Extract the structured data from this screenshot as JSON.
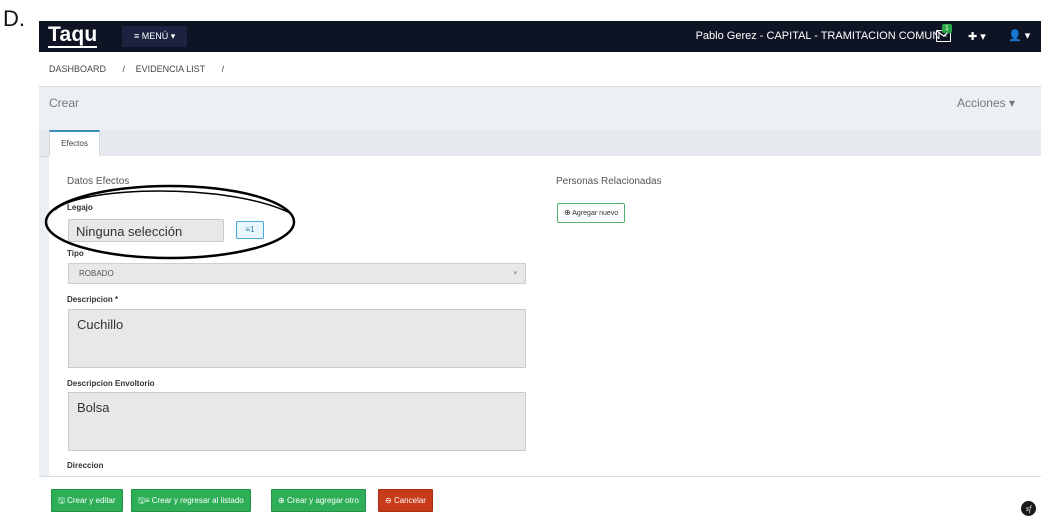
{
  "outer_label": "D.",
  "topbar": {
    "logo": "Taqu",
    "menu_label": "≡  MENÚ ▾",
    "user_info": "Pablo Gerez - CAPITAL - TRAMITACION COMUN -",
    "mail_badge": "1",
    "plus_label": "✚ ▾",
    "user_label": "👤 ▾"
  },
  "breadcrumb": {
    "item1": "DASHBOARD",
    "sep1": "/",
    "item2": "EVIDENCIA LIST",
    "sep2": "/"
  },
  "page": {
    "title": "Crear",
    "actions_label": "Acciones ▾"
  },
  "tabs": {
    "efectos": "Efectos"
  },
  "form": {
    "datos_title": "Datos Efectos",
    "legajo_label": "Legajo",
    "legajo_value": "Ninguna selección",
    "legajo_list_btn": "≡1",
    "tipo_label": "Tipo",
    "tipo_value": "ROBADO",
    "descripcion_label": "Descripcion *",
    "descripcion_value": "Cuchillo",
    "envoltorio_label": "Descripcion Envoltorio",
    "envoltorio_value": "Bolsa",
    "direccion_label": "Direccion",
    "personas_title": "Personas Relacionadas",
    "agregar_nuevo": "Agregar nuevo"
  },
  "footer": {
    "crear_editar": "Crear y editar",
    "crear_regresar": "Crear y regresar al listado",
    "crear_agregar": "Crear y agregar otro",
    "cancelar": "Cancelar"
  },
  "colors": {
    "topbar": "#0e1424",
    "green": "#2eaf57",
    "red": "#c73a1a",
    "annotation": "#000000"
  }
}
